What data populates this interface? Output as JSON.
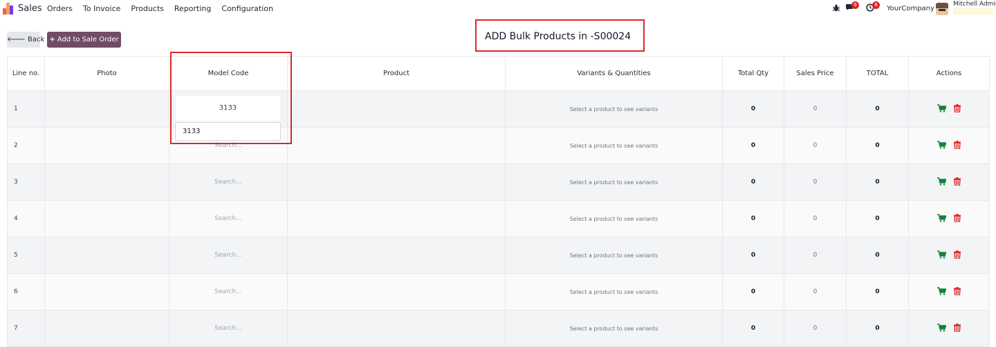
{
  "navbar": {
    "app_name": "Sales",
    "menu": [
      "Orders",
      "To Invoice",
      "Products",
      "Reporting",
      "Configuration"
    ],
    "chat_badge": "9",
    "activity_badge": "8",
    "company": "YourCompany",
    "user": "Mitchell Admin"
  },
  "toolbar": {
    "back_label": "Back",
    "add_label": "Add to Sale Order",
    "title": "ADD Bulk Products in -S00024"
  },
  "table": {
    "headers": [
      "Line no.",
      "Photo",
      "Model Code",
      "Product",
      "Variants & Quantities",
      "Total Qty",
      "Sales Price",
      "TOTAL",
      "Actions"
    ],
    "search_placeholder": "Search...",
    "variants_placeholder": "Select a product to see variants",
    "rows": [
      {
        "line": "1",
        "model_code": "3133",
        "total_qty": "0",
        "sales_price": "0",
        "total": "0"
      },
      {
        "line": "2",
        "model_code": "",
        "total_qty": "0",
        "sales_price": "0",
        "total": "0"
      },
      {
        "line": "3",
        "model_code": "",
        "total_qty": "0",
        "sales_price": "0",
        "total": "0"
      },
      {
        "line": "4",
        "model_code": "",
        "total_qty": "0",
        "sales_price": "0",
        "total": "0"
      },
      {
        "line": "5",
        "model_code": "",
        "total_qty": "0",
        "sales_price": "0",
        "total": "0"
      },
      {
        "line": "6",
        "model_code": "",
        "total_qty": "0",
        "sales_price": "0",
        "total": "0"
      },
      {
        "line": "7",
        "model_code": "",
        "total_qty": "0",
        "sales_price": "0",
        "total": "0"
      }
    ]
  },
  "dropdown": {
    "suggestion": "3133"
  },
  "colors": {
    "brand": "#714b67",
    "highlight": "#dc2626",
    "cart": "#15803d",
    "trash": "#dc2626"
  },
  "icons": {
    "back": "arrow-left-icon",
    "add": "plus-icon",
    "cart": "cart-icon",
    "trash": "trash-icon",
    "bug": "bug-icon",
    "chat": "chat-icon",
    "activity": "clock-icon"
  }
}
